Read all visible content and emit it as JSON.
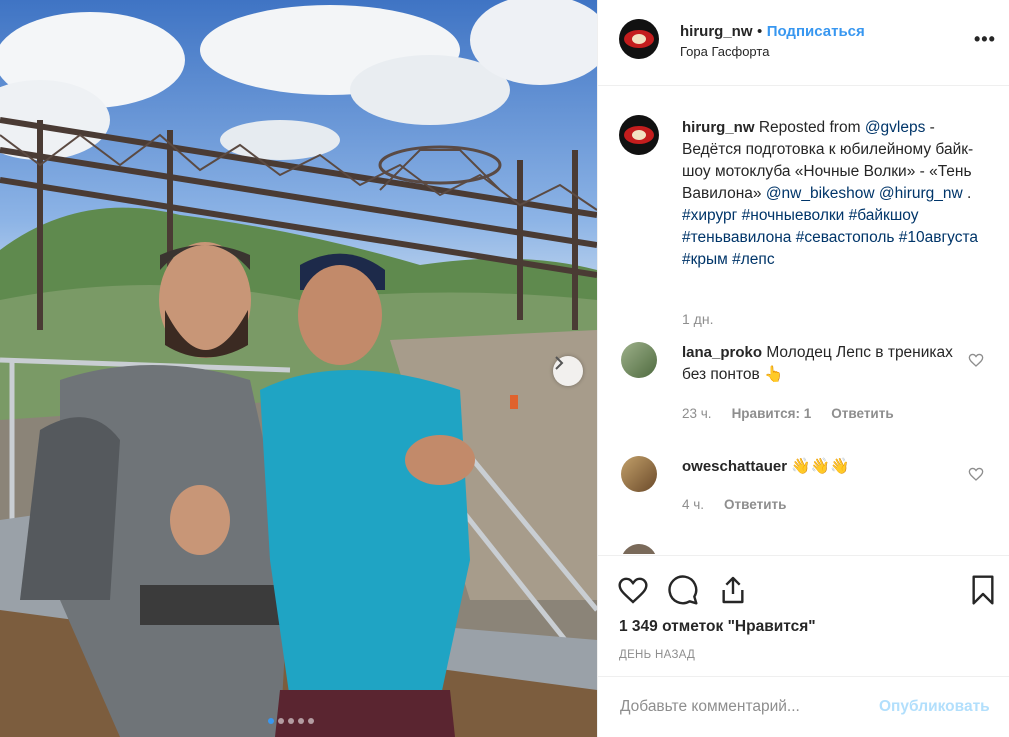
{
  "post": {
    "username": "hirurg_nw",
    "separator": "•",
    "follow_label": "Подписаться",
    "location": "Гора Гасфорта",
    "more_icon": "more-horizontal-icon"
  },
  "caption": {
    "username": "hirurg_nw",
    "text_1": "Reposted from",
    "mention_1": "@gvleps",
    "text_2": "- Ведётся подготовка к юбилейному байк-шоу мотоклуба «Ночные Волки» - «Тень Вавилона»",
    "mention_2": "@nw_bikeshow",
    "mention_3": "@hirurg_nw",
    "text_3": ".",
    "hashtags": [
      "#хирург",
      "#ночныеволки",
      "#байкшоу",
      "#теньвавилона",
      "#севастополь",
      "#10августа",
      "#крым",
      "#лепс"
    ],
    "time": "1 дн."
  },
  "comments": [
    {
      "username": "lana_proko",
      "text": "Молодец Лепс в трениках без понтов 👆",
      "time": "23 ч.",
      "likes": "Нравится: 1",
      "reply": "Ответить"
    },
    {
      "username": "oweschattauer",
      "text": "👋👋👋",
      "time": "4 ч.",
      "reply": "Ответить"
    }
  ],
  "actions": {
    "like_icon": "heart-icon",
    "comment_icon": "comment-icon",
    "share_icon": "share-icon",
    "save_icon": "bookmark-icon",
    "likes_count": "1 349 отметок \"Нравится\"",
    "date": "ДЕНЬ НАЗАД"
  },
  "add_comment": {
    "placeholder": "Добавьте комментарий...",
    "publish_label": "Опубликовать"
  },
  "carousel": {
    "total": 5,
    "active": 1
  },
  "colors": {
    "accent": "#3897f0",
    "link": "#003569",
    "muted": "#8e8e8e",
    "publish_disabled": "#b2dffc"
  }
}
